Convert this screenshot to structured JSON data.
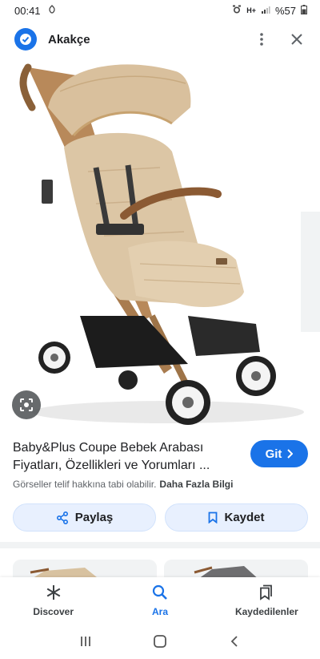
{
  "status_bar": {
    "time": "00:41",
    "battery": "%57",
    "network": "H+"
  },
  "top_bar": {
    "site_name": "Akakçe"
  },
  "result": {
    "title_line1": "Baby&Plus Coupe Bebek Arabası",
    "title_line2": "Fiyatları, Özellikleri ve Yorumları ...",
    "visit_label": "Git",
    "copyright_note": "Görseller telif hakkına tabi olabilir.",
    "more_info_label": "Daha Fazla Bilgi",
    "share_label": "Paylaş",
    "save_label": "Kaydet"
  },
  "bottom_nav": {
    "items": [
      {
        "label": "Discover",
        "icon": "asterisk-icon",
        "active": false
      },
      {
        "label": "Ara",
        "icon": "search-icon",
        "active": true
      },
      {
        "label": "Kaydedilenler",
        "icon": "bookmarks-icon",
        "active": false
      }
    ]
  },
  "colors": {
    "accent": "#1a73e8",
    "pill_bg": "#e8f0fe"
  }
}
